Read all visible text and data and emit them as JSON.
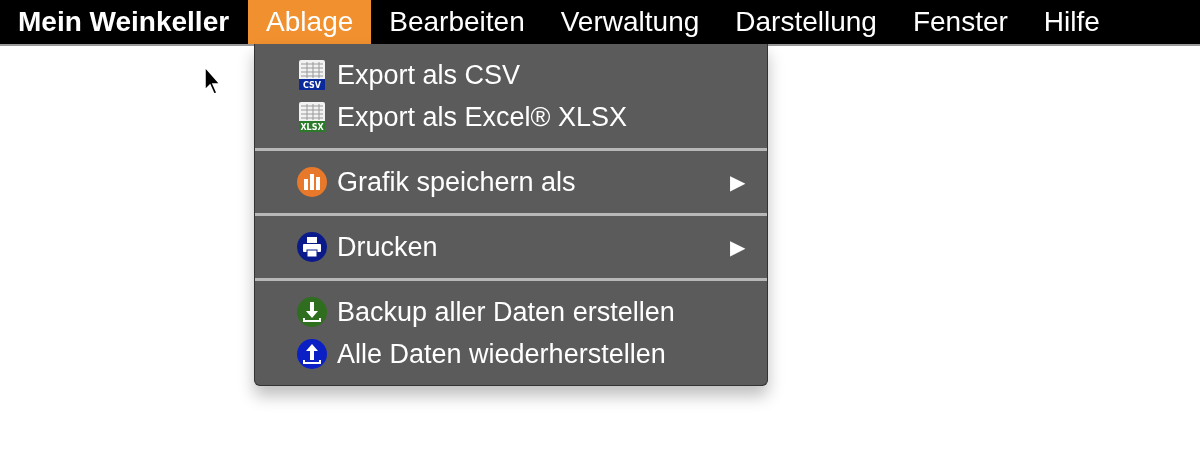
{
  "menubar": {
    "app_name": "Mein Weinkeller",
    "menus": [
      {
        "label": "Ablage",
        "selected": true
      },
      {
        "label": "Bearbeiten",
        "selected": false
      },
      {
        "label": "Verwaltung",
        "selected": false
      },
      {
        "label": "Darstellung",
        "selected": false
      },
      {
        "label": "Fenster",
        "selected": false
      },
      {
        "label": "Hilfe",
        "selected": false
      }
    ]
  },
  "dropdown": {
    "groups": [
      {
        "items": [
          {
            "label": "Export als CSV",
            "kind": "sheet",
            "badge": "CSV",
            "color": "#0a2a9c"
          },
          {
            "label": "Export als Excel® XLSX",
            "kind": "sheet",
            "badge": "XLSX",
            "color": "#2a7a2a"
          }
        ]
      },
      {
        "items": [
          {
            "label": "Grafik speichern als",
            "kind": "chart",
            "color": "#e8782a",
            "arrow": "▶"
          }
        ]
      },
      {
        "items": [
          {
            "label": "Drucken",
            "kind": "print",
            "color": "#0b1a8a",
            "arrow": "▶"
          }
        ]
      },
      {
        "items": [
          {
            "label": "Backup aller Daten erstellen",
            "kind": "download",
            "color": "#2e6e1e"
          },
          {
            "label": "Alle Daten wiederherstellen",
            "kind": "upload",
            "color": "#0a1fc4"
          }
        ]
      }
    ]
  }
}
